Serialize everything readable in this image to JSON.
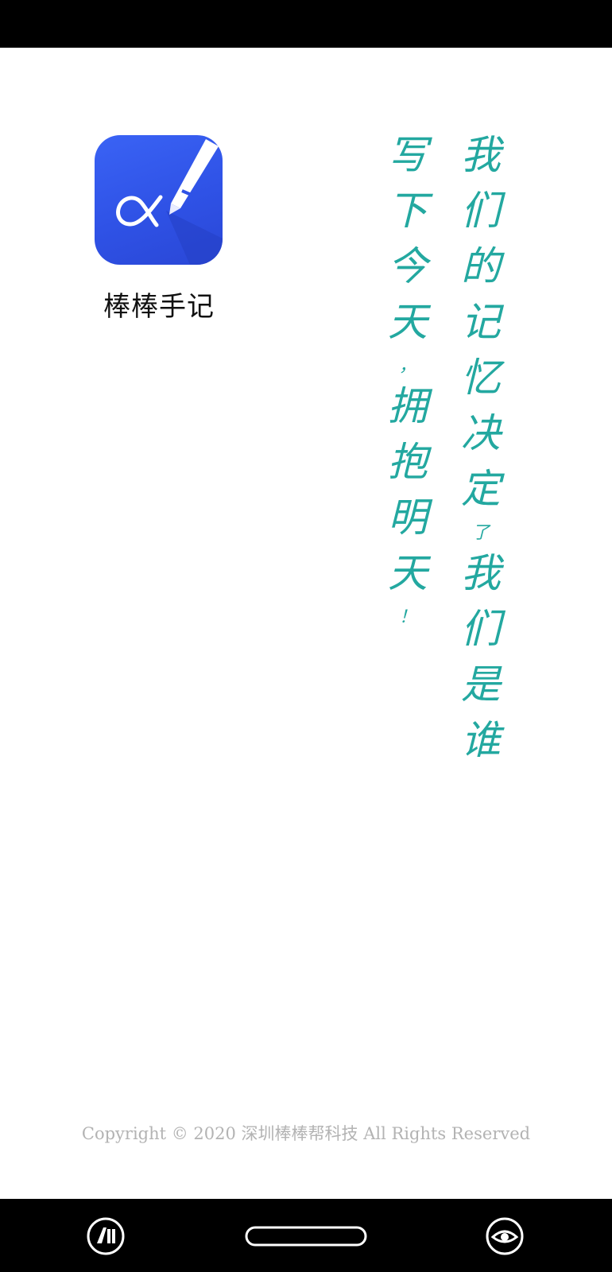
{
  "app": {
    "name": "棒棒手记",
    "icon": "alpha-pen-icon"
  },
  "poem": {
    "column1": [
      "我",
      "们",
      "的",
      "记",
      "忆",
      "决",
      "定",
      "了",
      "我",
      "们",
      "是",
      "谁"
    ],
    "column2": [
      "写",
      "下",
      "今",
      "天",
      "，",
      "拥",
      "抱",
      "明",
      "天",
      "！"
    ]
  },
  "footer": {
    "copyright": "Copyright © 2020 深圳棒棒帮科技 All Rights Reserved"
  },
  "navigation": {
    "left_icon": "ai-assistant-icon",
    "center_icon": "home-pill-icon",
    "right_icon": "eye-icon"
  },
  "colors": {
    "icon_blue": "#2f52e6",
    "poem_teal": "#23a8a0",
    "copyright_gray": "#b3b3b3"
  }
}
